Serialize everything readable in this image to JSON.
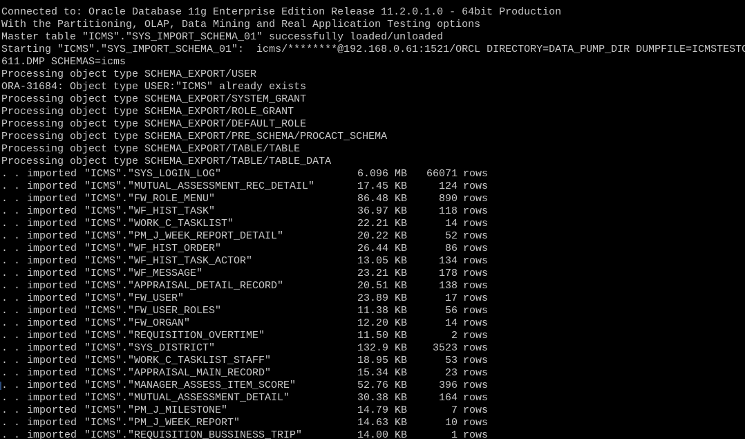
{
  "console": {
    "lines": [
      "Connected to: Oracle Database 11g Enterprise Edition Release 11.2.0.1.0 - 64bit Production",
      "With the Partitioning, OLAP, Data Mining and Real Application Testing options",
      "Master table \"ICMS\".\"SYS_IMPORT_SCHEMA_01\" successfully loaded/unloaded",
      "Starting \"ICMS\".\"SYS_IMPORT_SCHEMA_01\":  icms/********@192.168.0.61:1521/ORCL DIRECTORY=DATA_PUMP_DIR DUMPFILE=ICMSTESTC",
      "611.DMP SCHEMAS=icms",
      "Processing object type SCHEMA_EXPORT/USER",
      "ORA-31684: Object type USER:\"ICMS\" already exists",
      "Processing object type SCHEMA_EXPORT/SYSTEM_GRANT",
      "Processing object type SCHEMA_EXPORT/ROLE_GRANT",
      "Processing object type SCHEMA_EXPORT/DEFAULT_ROLE",
      "Processing object type SCHEMA_EXPORT/PRE_SCHEMA/PROCACT_SCHEMA",
      "Processing object type SCHEMA_EXPORT/TABLE/TABLE",
      "Processing object type SCHEMA_EXPORT/TABLE/TABLE_DATA"
    ],
    "row_prefix": ". .",
    "row_verb": "imported",
    "row_unit": "rows",
    "imports": [
      {
        "table": "\"ICMS\".\"SYS_LOGIN_LOG\"",
        "size": "6.096 MB",
        "rows": "66071"
      },
      {
        "table": "\"ICMS\".\"MUTUAL_ASSESSMENT_REC_DETAIL\"",
        "size": "17.45 KB",
        "rows": "124"
      },
      {
        "table": "\"ICMS\".\"FW_ROLE_MENU\"",
        "size": "86.48 KB",
        "rows": "890"
      },
      {
        "table": "\"ICMS\".\"WF_HIST_TASK\"",
        "size": "36.97 KB",
        "rows": "118"
      },
      {
        "table": "\"ICMS\".\"WORK_C_TASKLIST\"",
        "size": "22.21 KB",
        "rows": "14"
      },
      {
        "table": "\"ICMS\".\"PM_J_WEEK_REPORT_DETAIL\"",
        "size": "20.22 KB",
        "rows": "52"
      },
      {
        "table": "\"ICMS\".\"WF_HIST_ORDER\"",
        "size": "26.44 KB",
        "rows": "86"
      },
      {
        "table": "\"ICMS\".\"WF_HIST_TASK_ACTOR\"",
        "size": "13.05 KB",
        "rows": "134"
      },
      {
        "table": "\"ICMS\".\"WF_MESSAGE\"",
        "size": "23.21 KB",
        "rows": "178"
      },
      {
        "table": "\"ICMS\".\"APPRAISAL_DETAIL_RECORD\"",
        "size": "20.51 KB",
        "rows": "138"
      },
      {
        "table": "\"ICMS\".\"FW_USER\"",
        "size": "23.89 KB",
        "rows": "17"
      },
      {
        "table": "\"ICMS\".\"FW_USER_ROLES\"",
        "size": "11.38 KB",
        "rows": "56"
      },
      {
        "table": "\"ICMS\".\"FW_ORGAN\"",
        "size": "12.20 KB",
        "rows": "14"
      },
      {
        "table": "\"ICMS\".\"REQUISITION_OVERTIME\"",
        "size": "11.50 KB",
        "rows": "2"
      },
      {
        "table": "\"ICMS\".\"SYS_DISTRICT\"",
        "size": "132.9 KB",
        "rows": "3523"
      },
      {
        "table": "\"ICMS\".\"WORK_C_TASKLIST_STAFF\"",
        "size": "18.95 KB",
        "rows": "53"
      },
      {
        "table": "\"ICMS\".\"APPRAISAL_MAIN_RECORD\"",
        "size": "15.34 KB",
        "rows": "23"
      },
      {
        "table": "\"ICMS\".\"MANAGER_ASSESS_ITEM_SCORE\"",
        "size": "52.76 KB",
        "rows": "396"
      },
      {
        "table": "\"ICMS\".\"MUTUAL_ASSESSMENT_DETAIL\"",
        "size": "30.38 KB",
        "rows": "164"
      },
      {
        "table": "\"ICMS\".\"PM_J_MILESTONE\"",
        "size": "14.79 KB",
        "rows": "7"
      },
      {
        "table": "\"ICMS\".\"PM_J_WEEK_REPORT\"",
        "size": "14.63 KB",
        "rows": "10"
      },
      {
        "table": "\"ICMS\".\"REQUISITION_BUSSINESS_TRIP\"",
        "size": "14.00 KB",
        "rows": "1"
      }
    ]
  },
  "colors": {
    "background": "#000000",
    "foreground": "#c8c8c8"
  }
}
